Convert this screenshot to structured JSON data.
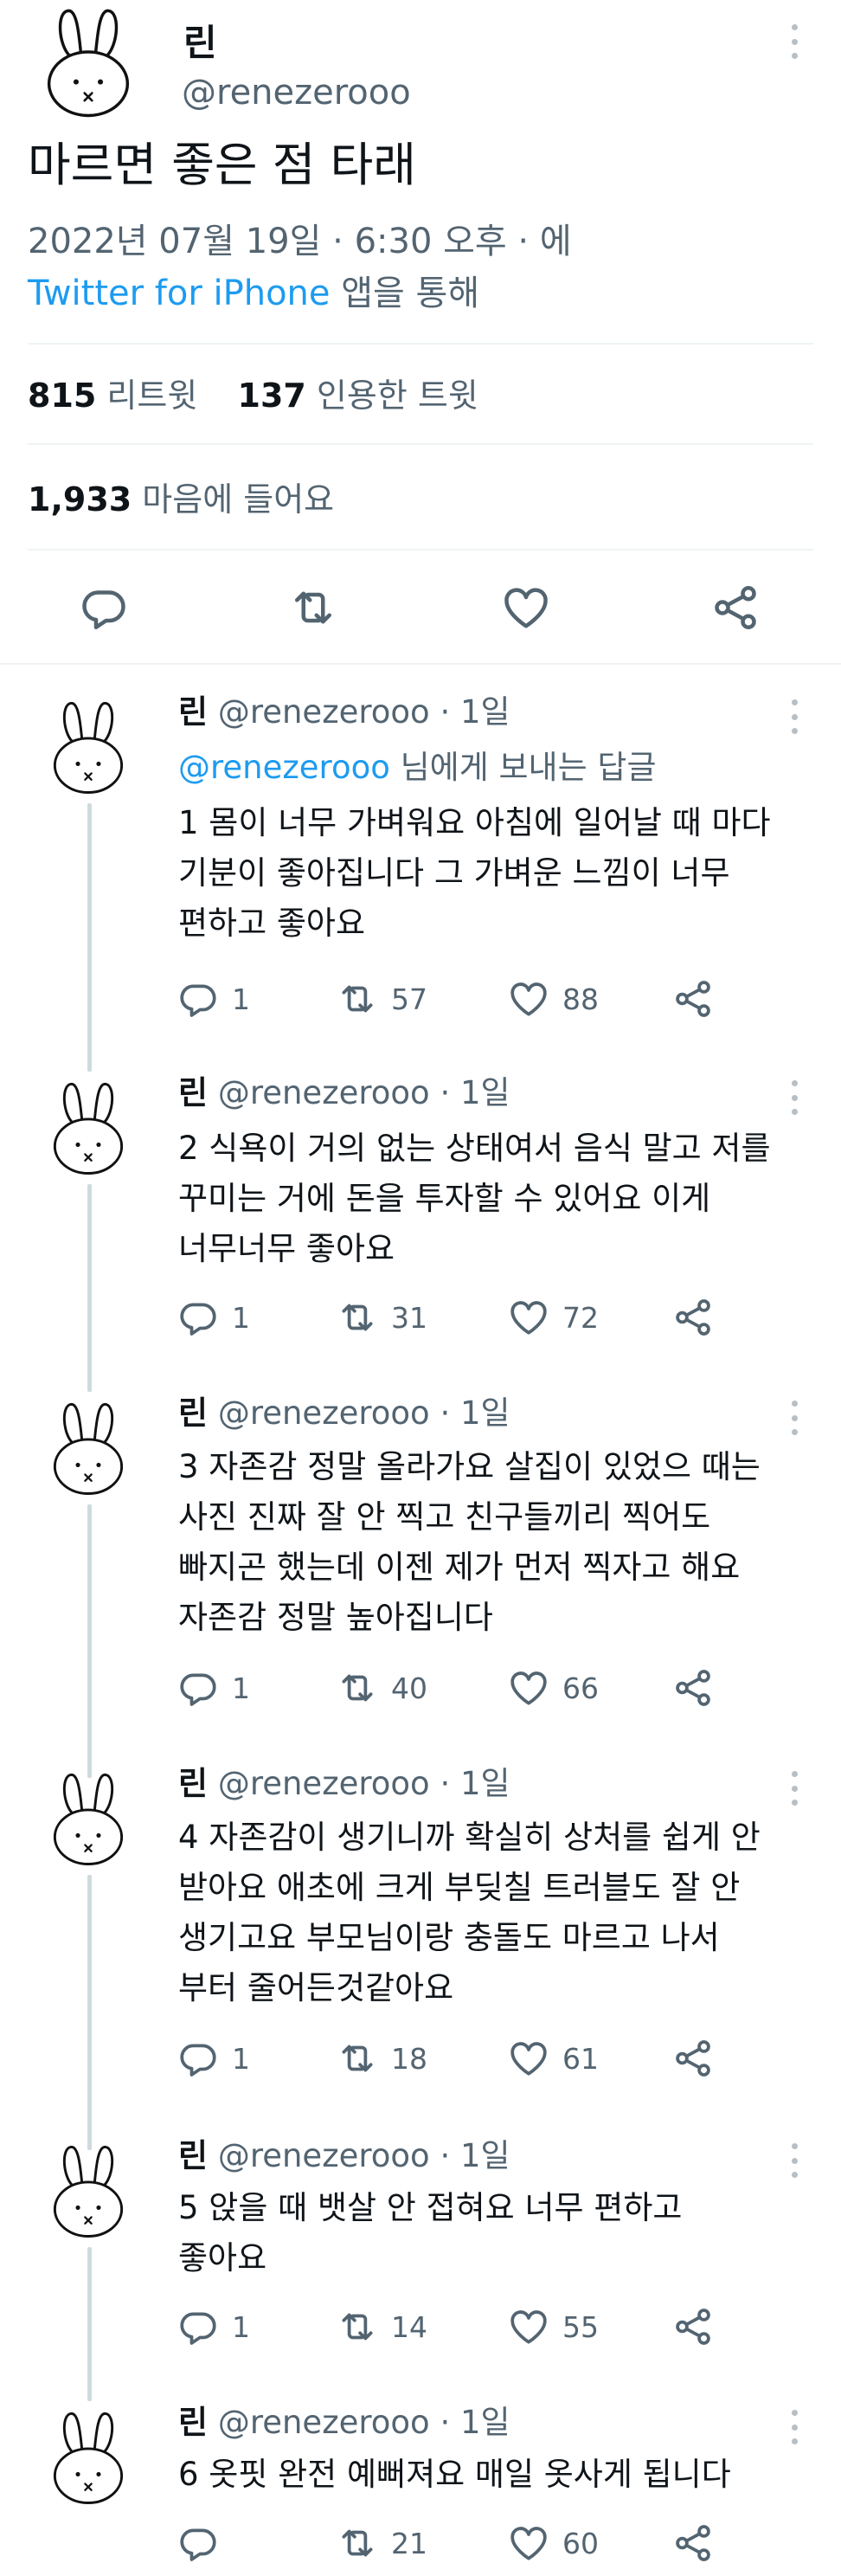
{
  "tweet": {
    "author_name": "린",
    "author_handle": "@renezerooo",
    "text": "마르면 좋은 점 타래",
    "date": "2022년 07월 19일 · 6:30 오후 · 에",
    "source_link": "Twitter for iPhone",
    "source_suffix": "앱을 통해",
    "retweets_count": "815",
    "retweets_label": "리트윗",
    "quotes_count": "137",
    "quotes_label": "인용한 트윗",
    "likes_count": "1,933",
    "likes_label": "마음에 들어요"
  },
  "replies": [
    {
      "name": "린",
      "handle": "@renezerooo",
      "time": "· 1일",
      "reply_to_handle": "@renezerooo",
      "reply_to_suffix": "님에게 보내는 답글",
      "text": "1 몸이 너무 가벼워요 아침에 일어날 때 마다\n기분이 좋아집니다 그 가벼운 느낌이 너무\n편하고 좋아요",
      "replies": "1",
      "retweets": "57",
      "likes": "88"
    },
    {
      "name": "린",
      "handle": "@renezerooo",
      "time": "· 1일",
      "text": "2 식욕이 거의 없는 상태여서 음식 말고 저를\n꾸미는 거에 돈을 투자할 수 있어요 이게\n너무너무 좋아요",
      "replies": "1",
      "retweets": "31",
      "likes": "72"
    },
    {
      "name": "린",
      "handle": "@renezerooo",
      "time": "· 1일",
      "text": "3 자존감 정말 올라가요 살집이 있었으 때는\n사진 진짜 잘 안 찍고 친구들끼리 찍어도\n빠지곤 했는데 이젠 제가 먼저 찍자고 해요\n자존감 정말 높아집니다",
      "replies": "1",
      "retweets": "40",
      "likes": "66"
    },
    {
      "name": "린",
      "handle": "@renezerooo",
      "time": "· 1일",
      "text": "4 자존감이 생기니까 확실히 상처를 쉽게 안\n받아요 애초에 크게 부딪칠 트러블도 잘 안\n생기고요 부모님이랑 충돌도 마르고 나서\n부터 줄어든것같아요",
      "replies": "1",
      "retweets": "18",
      "likes": "61"
    },
    {
      "name": "린",
      "handle": "@renezerooo",
      "time": "· 1일",
      "text": "5 앉을 때 뱃살 안 접혀요 너무 편하고\n좋아요",
      "replies": "1",
      "retweets": "14",
      "likes": "55"
    },
    {
      "name": "린",
      "handle": "@renezerooo",
      "time": "· 1일",
      "text": "6 옷핏 완전 예뻐져요 매일 옷사게 됩니다",
      "replies": "",
      "retweets": "21",
      "likes": "60"
    }
  ],
  "icons": {
    "avatar": "miffy-bunny-avatar",
    "more": "more-vertical-icon",
    "reply": "reply-icon",
    "retweet": "retweet-icon",
    "like": "heart-icon",
    "share": "share-icon"
  },
  "colors": {
    "link": "#1d9bf0",
    "text": "#0f1419",
    "muted": "#536471",
    "divider": "#eff3f4",
    "thread_line": "#cfd9de"
  }
}
